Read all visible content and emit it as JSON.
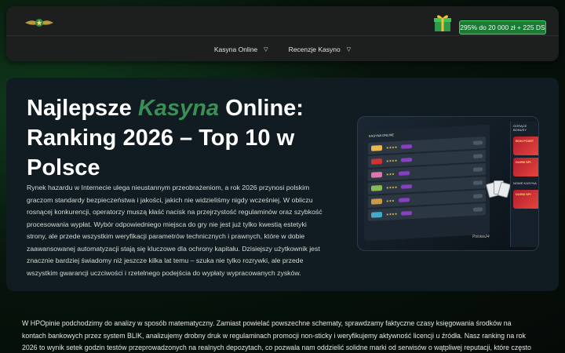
{
  "header": {
    "logo": "logo-wings-star",
    "bonus_label": "295% do 20 000 zł + 225 DS",
    "menu": [
      {
        "label": "Kasyna Online",
        "caret": "▽"
      },
      {
        "label": "Recenzje Kasyno",
        "caret": "▽"
      }
    ]
  },
  "hero": {
    "title_part1": "Najlepsze ",
    "title_accent": "Kasyna",
    "title_part2": " Online: Ranking 2026 – Top 10 w Polsce",
    "intro": "Rynek hazardu w Internecie ulega nieustannym przeobrażeniom, a rok 2026 przynosi polskim graczom standardy bezpieczeństwa i jakości, jakich nie widzieliśmy nigdy wcześniej. W obliczu rosnącej konkurencji, operatorzy muszą kłaść nacisk na przejrzystość regulaminów oraz szybkość procesowania wypłat. Wybór odpowiedniego miejsca do gry nie jest już tylko kwestią estetyki strony, ale przede wszystkim weryfikacji parametrów technicznych i prawnych, które w dobie zaawansowanej automatyzacji stają się kluczowe dla ochrony kapitału. Dzisiejszy użytkownik jest znacznie bardziej świadomy niż jeszcze kilka lat temu – szuka nie tylko rozrywki, ale przede wszystkim gwarancji uczciwości i rzetelnego podejścia do wypłaty wypracowanych zysków.",
    "mockup": {
      "table_title": "KASYNA ONLINE",
      "side_title": "GORĄCE BONUSY",
      "side_tiles": [
        "BON POWIT",
        "DARM SPI",
        "DARM SPI"
      ],
      "side_title2": "NOWE KASYNA",
      "brand": "Polskie24"
    }
  },
  "article": {
    "paragraph": "W HPOpinie podchodzimy do analizy w sposób matematyczny. Zamiast powielać powszechne schematy, sprawdzamy faktyczne czasy księgowania środków na kontach bankowych przez system BLIK, analizujemy drobny druk w regulaminach promocji non-sticky i weryfikujemy aktywność licencji u źródła. Nasz ranking na rok 2026 to wynik setek godzin testów przeprowadzonych na realnych depozytach, co pozwala nam oddzielić solidne marki od serwisów o wątpliwej reputacji, które często stosują"
  },
  "colors": {
    "accent_green": "#3a8f55",
    "bonus_bg": "#1d7a35",
    "hero_bg": "#101c21",
    "nav_bg": "#1c1f1e"
  }
}
